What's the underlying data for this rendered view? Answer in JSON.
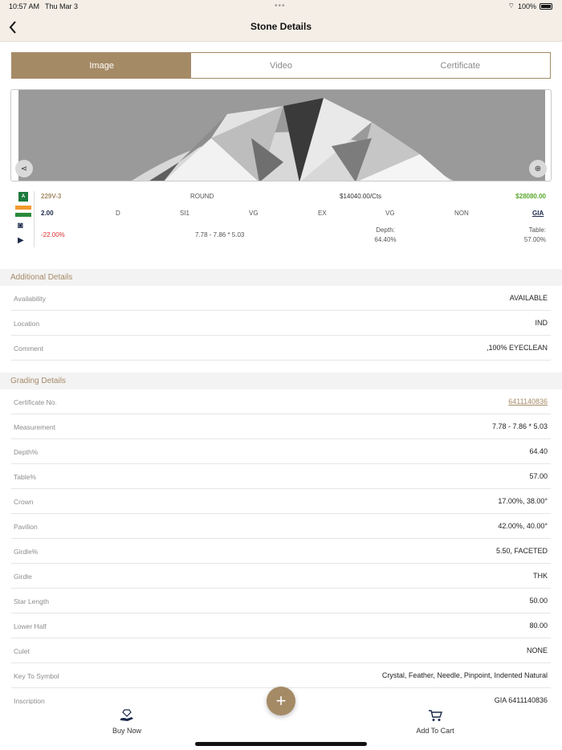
{
  "status": {
    "time": "10:57 AM",
    "date": "Thu Mar 3",
    "battery": "100%"
  },
  "header": {
    "title": "Stone Details"
  },
  "tabs": [
    {
      "label": "Image",
      "active": true
    },
    {
      "label": "Video",
      "active": false
    },
    {
      "label": "Certificate",
      "active": false
    }
  ],
  "summary": {
    "grade_badge": "A",
    "stone_id": "229V-3",
    "shape": "ROUND",
    "price_per_ct": "$14040.00/Cts",
    "total_price": "$28080.00",
    "carat": "2.00",
    "color": "D",
    "clarity": "SI1",
    "cut": "VG",
    "polish": "EX",
    "symmetry": "VG",
    "fluorescence": "NON",
    "lab": "GIA",
    "discount": "-22.00%",
    "measurement": "7.78 - 7.86 * 5.03",
    "depth_label": "Depth:",
    "depth_value": "64.40%",
    "table_label": "Table:",
    "table_value": "57.00%"
  },
  "additional": {
    "title": "Additional Details",
    "rows": [
      {
        "label": "Availability",
        "value": "AVAILABLE"
      },
      {
        "label": "Location",
        "value": "IND"
      },
      {
        "label": "Comment",
        "value": ",100% EYECLEAN"
      }
    ]
  },
  "grading": {
    "title": "Grading Details",
    "rows": [
      {
        "label": "Certificate No.",
        "value": "6411140836"
      },
      {
        "label": "Measurement",
        "value": "7.78 - 7.86 * 5.03"
      },
      {
        "label": "Depth%",
        "value": "64.40"
      },
      {
        "label": "Table%",
        "value": "57.00"
      },
      {
        "label": "Crown",
        "value": "17.00%, 38.00°"
      },
      {
        "label": "Pavilion",
        "value": "42.00%, 40.00°"
      },
      {
        "label": "Girdle%",
        "value": "5.50, FACETED"
      },
      {
        "label": "Girdle",
        "value": "THK"
      },
      {
        "label": "Star Length",
        "value": "50.00"
      },
      {
        "label": "Lower Half",
        "value": "80.00"
      },
      {
        "label": "Culet",
        "value": "NONE"
      },
      {
        "label": "Key To Symbol",
        "value": "Crystal, Feather, Needle, Pinpoint, Indented Natural"
      },
      {
        "label": "Inscription",
        "value": "GIA 6411140836"
      }
    ]
  },
  "bottom_nav": {
    "buy_now": "Buy Now",
    "add_to_cart": "Add To Cart",
    "fab": "+"
  },
  "colors": {
    "accent": "#a58a66",
    "green": "#5aa92e",
    "red": "#e03030",
    "navy": "#1c2a4a"
  }
}
